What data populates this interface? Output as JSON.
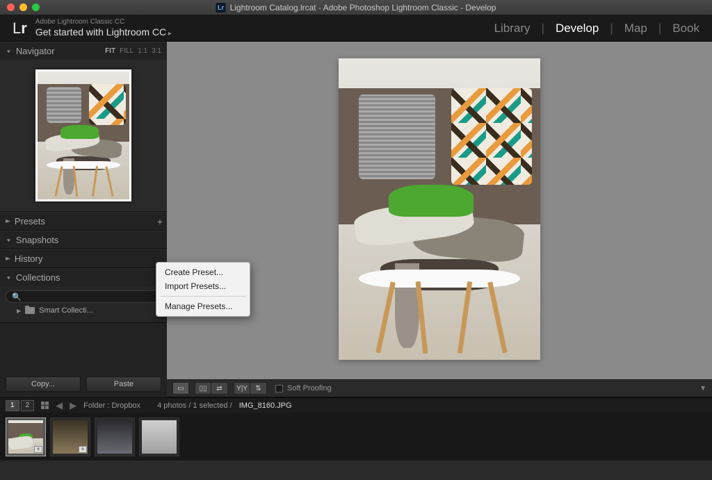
{
  "titlebar": {
    "title": "Lightroom Catalog.lrcat - Adobe Photoshop Lightroom Classic - Develop"
  },
  "brand": {
    "sub": "Adobe Lightroom Classic CC",
    "main": "Get started with Lightroom CC",
    "logo_l": "L",
    "logo_r": "r"
  },
  "modules": {
    "library": "Library",
    "develop": "Develop",
    "map": "Map",
    "book": "Book"
  },
  "panels": {
    "navigator": "Navigator",
    "nav_opts": {
      "fit": "FIT",
      "fill": "FILL",
      "one": "1:1",
      "ratio": "3:1"
    },
    "presets": "Presets",
    "snapshots": "Snapshots",
    "history": "History",
    "collections": "Collections",
    "search_placeholder": "",
    "smart": "Smart Collecti..."
  },
  "buttons": {
    "copy": "Copy...",
    "paste": "Paste"
  },
  "toolbar": {
    "soft_proof": "Soft Proofing"
  },
  "context": {
    "create": "Create Preset...",
    "import": "Import Presets...",
    "manage": "Manage Presets..."
  },
  "filmstrip": {
    "tab1": "1",
    "tab2": "2",
    "source": "Folder : Dropbox",
    "count": "4 photos / 1 selected /",
    "filename": "IMG_8160.JPG"
  }
}
